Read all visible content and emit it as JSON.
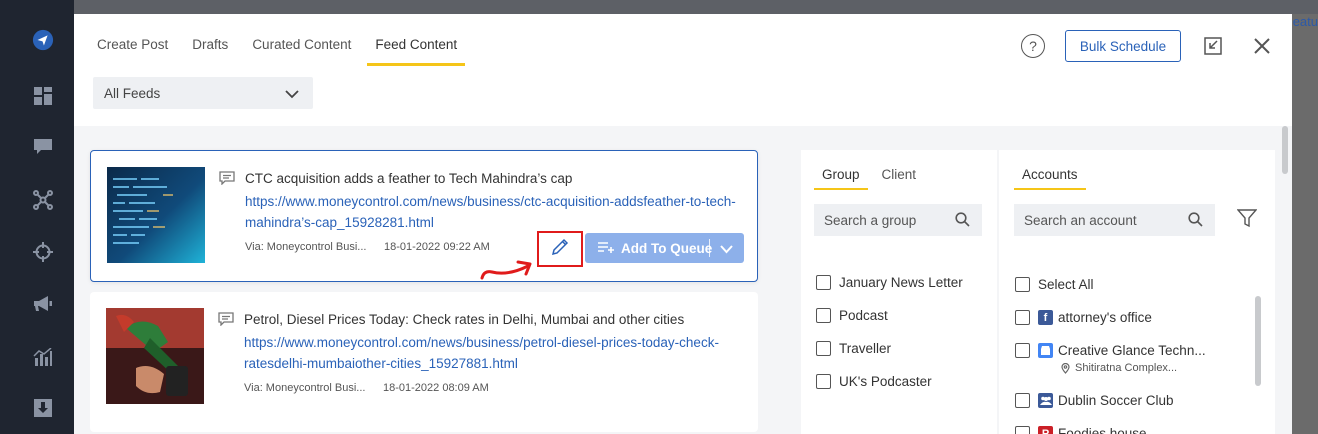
{
  "background": {
    "partial_text": "eatu"
  },
  "leftnav": {
    "items": [
      "logo-icon",
      "dashboard-icon",
      "chat-icon",
      "network-icon",
      "target-icon",
      "megaphone-icon",
      "analytics-icon",
      "download-icon"
    ]
  },
  "tabs": [
    {
      "label": "Create Post"
    },
    {
      "label": "Drafts"
    },
    {
      "label": "Curated Content"
    },
    {
      "label": "Feed Content",
      "active": true
    }
  ],
  "toolbar": {
    "help_label": "?",
    "bulk_label": "Bulk Schedule"
  },
  "feed_select": {
    "value": "All Feeds"
  },
  "cards": [
    {
      "title": "CTC acquisition adds a feather to Tech Mahindra’s cap",
      "link": "https://www.moneycontrol.com/news/business/ctc-acquisition-addsfeather-to-tech-mahindra’s-cap_15928281.html",
      "via": "Via: Moneycontrol Busi...",
      "date": "18-01-2022 09:22 AM",
      "queue_label": "Add To Queue"
    },
    {
      "title": "Petrol, Diesel Prices Today: Check rates in Delhi, Mumbai and other cities",
      "link": "https://www.moneycontrol.com/news/business/petrol-diesel-prices-today-check-ratesdelhi-mumbaiother-cities_15927881.html",
      "via": "Via: Moneycontrol Busi...",
      "date": "18-01-2022 08:09 AM"
    }
  ],
  "groups_panel": {
    "tabs": [
      {
        "label": "Group",
        "active": true
      },
      {
        "label": "Client"
      }
    ],
    "search_placeholder": "Search a group",
    "items": [
      "January News Letter",
      "Podcast",
      "Traveller",
      "UK's Podcaster"
    ]
  },
  "accounts_panel": {
    "tab": "Accounts",
    "search_placeholder": "Search an account",
    "select_all": "Select All",
    "items": [
      {
        "name": "attorney's office",
        "icon": "facebook-icon",
        "color": "#3b5998"
      },
      {
        "name": "Creative Glance Techn...",
        "sub": "Shitiratna Complex...",
        "icon": "google-business-icon",
        "color": "#4285f4"
      },
      {
        "name": "Dublin Soccer Club",
        "icon": "facebook-group-icon",
        "color": "#3b5998"
      },
      {
        "name": "Foodies house",
        "icon": "pinterest-icon",
        "color": "#cb2027"
      }
    ]
  },
  "colors": {
    "accent": "#2a62b8",
    "tab_underline": "#f5c518",
    "queue_button": "#8db0ea",
    "highlight": "#e01b1b"
  }
}
